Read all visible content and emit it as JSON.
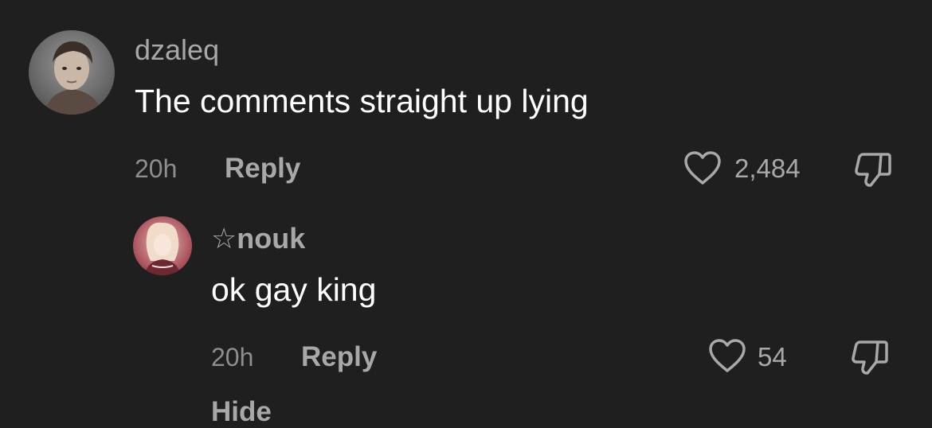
{
  "comments": [
    {
      "username": "dzaleq",
      "text": "The comments straight up lying",
      "time": "20h",
      "reply_label": "Reply",
      "like_count": "2,484"
    },
    {
      "username": "☆nouk",
      "text": "ok gay king",
      "time": "20h",
      "reply_label": "Reply",
      "like_count": "54"
    }
  ],
  "cut_off_text": "Hide",
  "icons": {
    "like": "heart-icon",
    "dislike": "thumbs-down-icon"
  },
  "colors": {
    "background": "#1f1f1f",
    "primary_text": "#ffffff",
    "secondary_text": "#a8a8a8",
    "muted_text": "#8e8e8e"
  }
}
